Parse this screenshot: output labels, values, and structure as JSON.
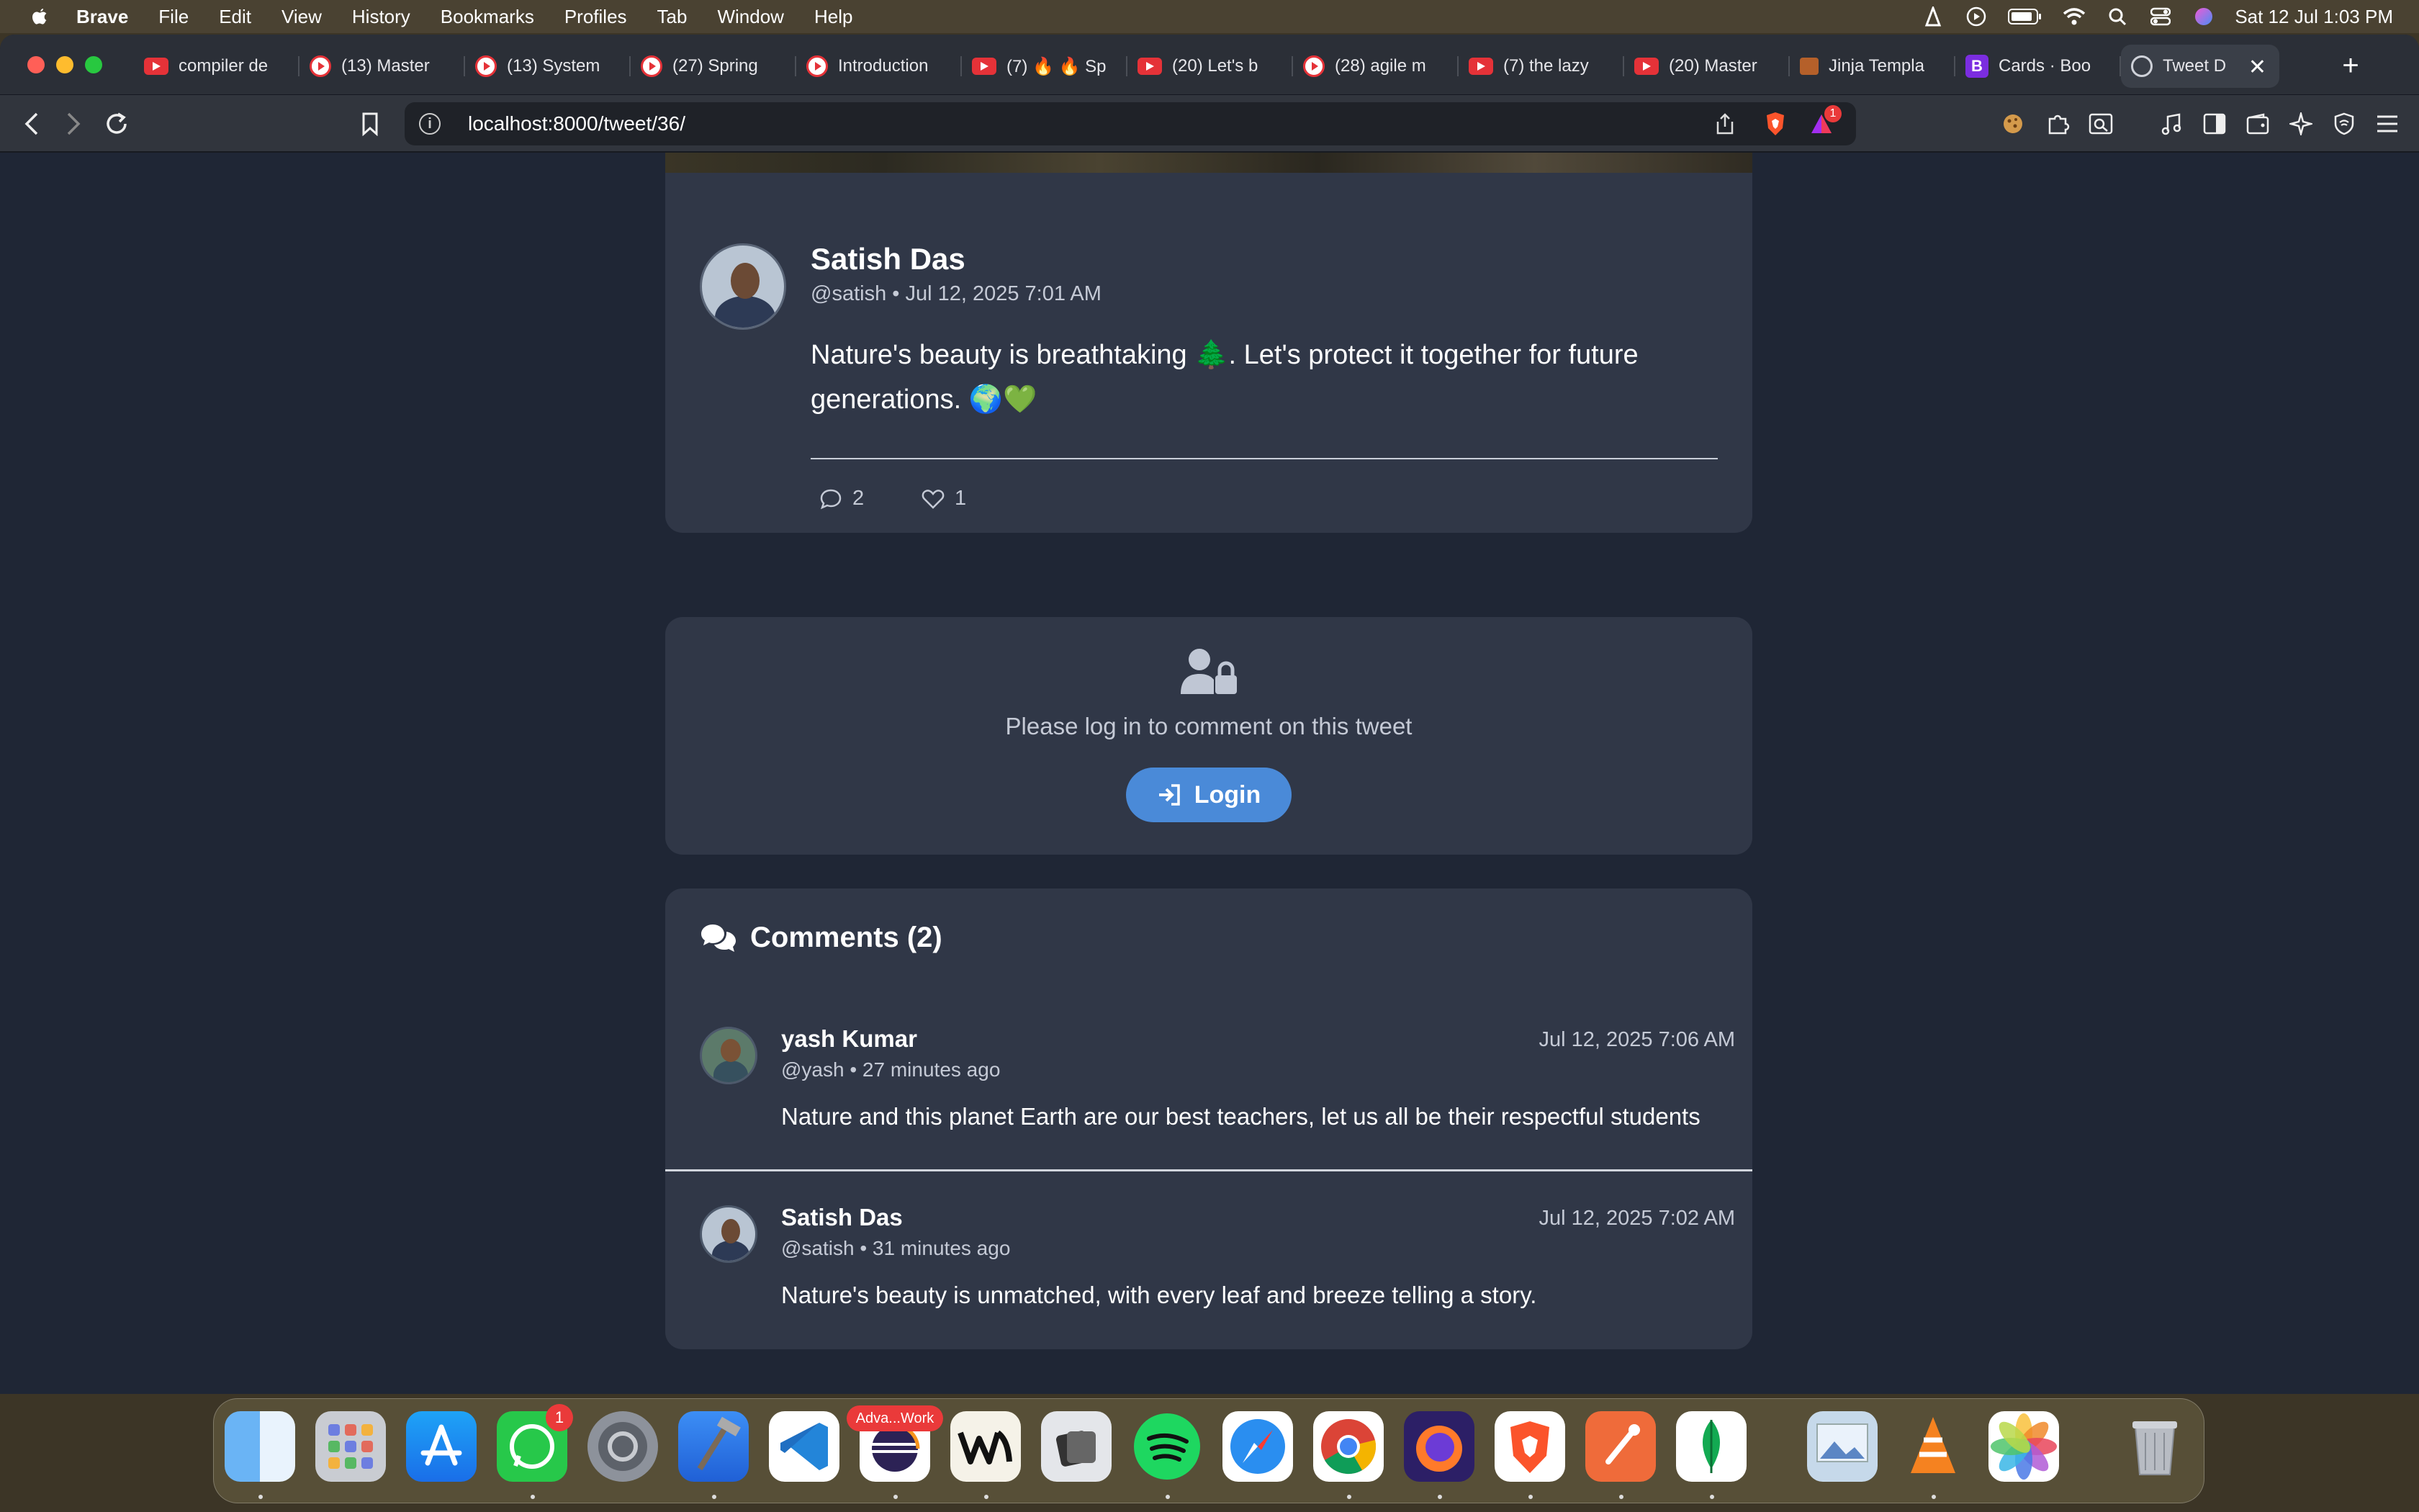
{
  "menubar": {
    "app": "Brave",
    "items": [
      "File",
      "Edit",
      "View",
      "History",
      "Bookmarks",
      "Profiles",
      "Tab",
      "Window",
      "Help"
    ],
    "datetime": "Sat 12 Jul  1:03 PM"
  },
  "tabs": [
    {
      "title": "compiler de",
      "icon": "youtube-icon"
    },
    {
      "title": "(13) Master",
      "icon": "youtube-live-icon"
    },
    {
      "title": "(13) System",
      "icon": "youtube-live-icon"
    },
    {
      "title": "(27) Spring",
      "icon": "youtube-live-icon"
    },
    {
      "title": "Introduction",
      "icon": "youtube-live-icon"
    },
    {
      "title": "(7) 🔥 🔥 Sp",
      "icon": "youtube-icon"
    },
    {
      "title": "(20) Let's b",
      "icon": "youtube-icon"
    },
    {
      "title": "(28) agile m",
      "icon": "youtube-live-icon"
    },
    {
      "title": "(7) the lazy",
      "icon": "youtube-icon"
    },
    {
      "title": "(20) Master",
      "icon": "youtube-icon"
    },
    {
      "title": "Jinja Templa",
      "icon": "jinja-icon"
    },
    {
      "title": "Cards · Boo",
      "icon": "bootstrap-icon"
    },
    {
      "title": "Tweet D",
      "icon": "globe-icon",
      "active": true
    }
  ],
  "url": "localhost:8000/tweet/36/",
  "brave_badge": "1",
  "tweet": {
    "name": "Satish Das",
    "meta": "@satish • Jul 12, 2025 7:01 AM",
    "text": "Nature's beauty is breathtaking 🌲. Let's protect it together for future generations. 🌍💚",
    "comments_count": "2",
    "likes_count": "1"
  },
  "login": {
    "message": "Please log in to comment on this tweet",
    "button": "Login"
  },
  "comments": {
    "title": "Comments (2)",
    "items": [
      {
        "name": "yash Kumar",
        "meta": "@yash • 27 minutes ago",
        "date": "Jul 12, 2025 7:06 AM",
        "text": "Nature and this planet Earth are our best teachers, let us all be their respectful students"
      },
      {
        "name": "Satish Das",
        "meta": "@satish • 31 minutes ago",
        "date": "Jul 12, 2025 7:02 AM",
        "text": "Nature's beauty is unmatched, with every leaf and breeze telling a story."
      }
    ]
  },
  "dock": {
    "apps": [
      "Finder",
      "Launchpad",
      "App Store",
      "WhatsApp",
      "System Settings",
      "Xcode",
      "Visual Studio Code",
      "Eclipse",
      "Notion-like W",
      "Notes",
      "Spotify",
      "Safari",
      "Chrome",
      "Firefox",
      "Brave",
      "Postman",
      "MongoDB",
      "Preview",
      "VLC",
      "Photos",
      "Trash"
    ],
    "whatsapp_badge": "1",
    "eclipse_label": "Adva...Work"
  }
}
